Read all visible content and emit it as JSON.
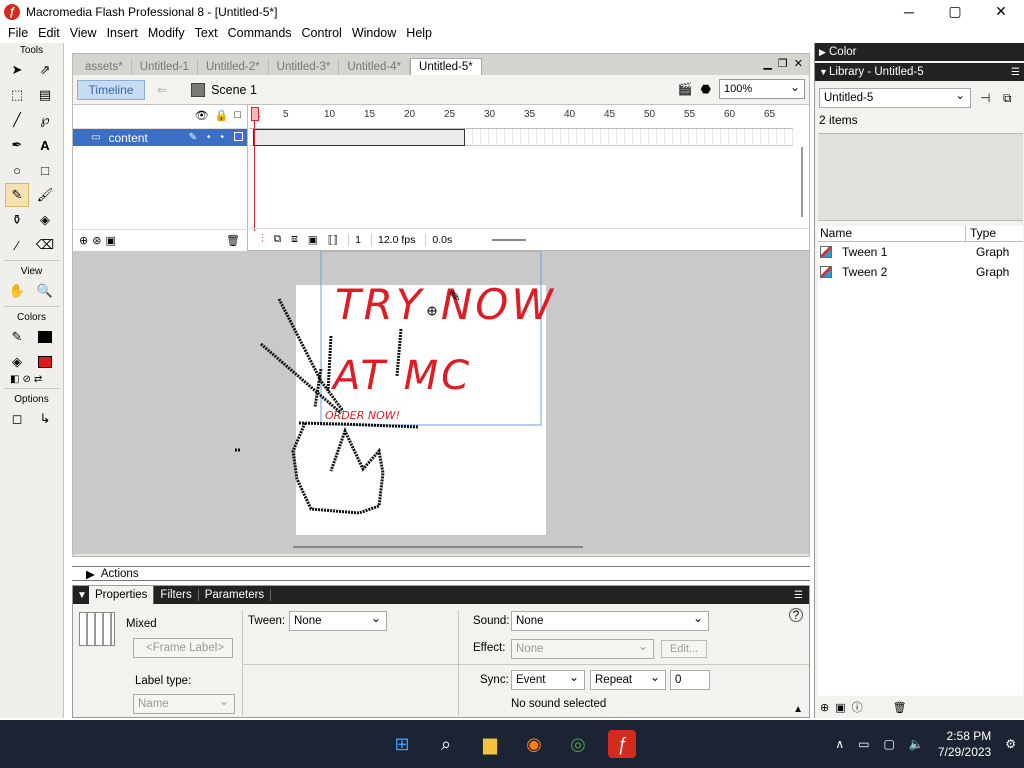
{
  "window": {
    "title": "Macromedia Flash Professional 8 - [Untitled-5*]",
    "minimize": "─",
    "maximize": "▢",
    "close": "✕"
  },
  "menu": [
    "File",
    "Edit",
    "View",
    "Insert",
    "Modify",
    "Text",
    "Commands",
    "Control",
    "Window",
    "Help"
  ],
  "tools": {
    "title": "Tools",
    "view_title": "View",
    "colors_title": "Colors",
    "options_title": "Options",
    "stroke_color": "#000000",
    "fill_color": "#e11b1b"
  },
  "document": {
    "tabs": [
      "assets*",
      "Untitled-1",
      "Untitled-2*",
      "Untitled-3*",
      "Untitled-4*",
      "Untitled-5*"
    ],
    "active_tab": "Untitled-5*",
    "timeline_button": "Timeline",
    "scene": "Scene 1",
    "zoom": "100%"
  },
  "timeline": {
    "layer_name": "content",
    "ruler": [
      "1",
      "5",
      "10",
      "15",
      "20",
      "25",
      "30",
      "35",
      "40",
      "45",
      "50",
      "55",
      "60",
      "65"
    ],
    "current_frame": "1",
    "fps": "12.0 fps",
    "time": "0.0s"
  },
  "stage": {
    "headline1": "TRY NOW",
    "headline2": "AT MC",
    "subline": "ORDER NOW!"
  },
  "actions": {
    "title": "Actions"
  },
  "properties": {
    "tabs": [
      "Properties",
      "Filters",
      "Parameters"
    ],
    "frame_type": "Mixed",
    "frame_label_placeholder": "<Frame Label>",
    "label_type_label": "Label type:",
    "label_type_value": "Name",
    "tween_label": "Tween:",
    "tween_value": "None",
    "sound_label": "Sound:",
    "sound_value": "None",
    "effect_label": "Effect:",
    "effect_value": "None",
    "edit_button": "Edit...",
    "sync_label": "Sync:",
    "sync_value": "Event",
    "repeat_value": "Repeat",
    "repeat_count": "0",
    "sound_status": "No sound selected"
  },
  "right_panel": {
    "color_title": "Color",
    "library_title": "Library - Untitled-5",
    "library_doc": "Untitled-5",
    "item_count": "2 items",
    "col_name": "Name",
    "col_type": "Type",
    "items": [
      {
        "name": "Tween 1",
        "type": "Graph"
      },
      {
        "name": "Tween 2",
        "type": "Graph"
      }
    ]
  },
  "taskbar": {
    "time": "2:58 PM",
    "date": "7/29/2023"
  }
}
